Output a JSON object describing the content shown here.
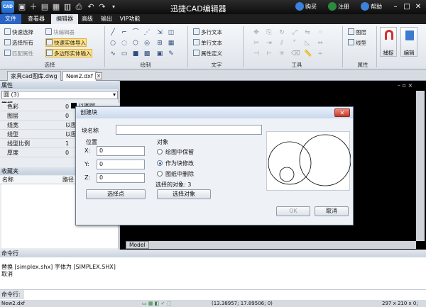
{
  "app": {
    "logo_text": "CAD",
    "title": "迅捷CAD编辑器",
    "right_items": [
      "购买",
      "注册",
      "帮助"
    ]
  },
  "menus": [
    "文件",
    "查看器",
    "编辑器",
    "高级",
    "输出",
    "VIP功能"
  ],
  "ribbon": {
    "select_group": {
      "label": "选择",
      "items": [
        "快速选择",
        "选择所有",
        "匹配属性",
        "块编辑器",
        "快速实体导入",
        "多边形实体输入"
      ]
    },
    "draw_group": {
      "label": "绘制"
    },
    "text_group": {
      "label": "文字",
      "items": [
        "多行文本",
        "单行文本",
        "属性定义"
      ]
    },
    "tools_group": {
      "label": "工具"
    },
    "attr_group": {
      "label": "属性",
      "items": [
        "图层",
        "线型"
      ]
    },
    "big_buttons": [
      "捕捉",
      "编辑"
    ]
  },
  "tabs": [
    "家具cad图库.dwg",
    "New2.dxf"
  ],
  "properties": {
    "title": "属性",
    "selector": "圆 (3)",
    "group": "常规",
    "rows": [
      {
        "k": "色彩",
        "v": "0"
      },
      {
        "k": "图层",
        "v": "0"
      },
      {
        "k": "线宽",
        "v": "以图层"
      },
      {
        "k": "线型",
        "v": "以图层"
      },
      {
        "k": "线型比例",
        "v": "1"
      },
      {
        "k": "厚度",
        "v": "0"
      }
    ],
    "first_value": "以图层"
  },
  "favorites": {
    "title": "收藏夹",
    "columns": [
      "名称",
      "路径"
    ]
  },
  "model_tab": "Model",
  "command": {
    "title": "命令行",
    "lines": [
      "替换 [simplex.shx] 字体为 [SIMPLEX.SHX]",
      "取消"
    ],
    "prompt": "命令行:"
  },
  "status": {
    "file": "New2.dxf",
    "coords": "(13.38957; 17.89506; 0)",
    "size": "297 x 210 x 0;"
  },
  "dialog": {
    "title": "创建块",
    "name_label": "块名称",
    "name_value": "",
    "position_label": "位置",
    "x_label": "X:",
    "y_label": "Y:",
    "z_label": "Z:",
    "x_value": "0",
    "y_value": "0",
    "z_value": "0",
    "pick_point": "选择点",
    "object_label": "对象",
    "options": [
      "绘图中保留",
      "作为块修改",
      "图纸中删除"
    ],
    "selected_option": 1,
    "selected_count": "选择的对象: 3",
    "select_objects": "选择对象",
    "ok": "OK",
    "cancel": "取消"
  }
}
